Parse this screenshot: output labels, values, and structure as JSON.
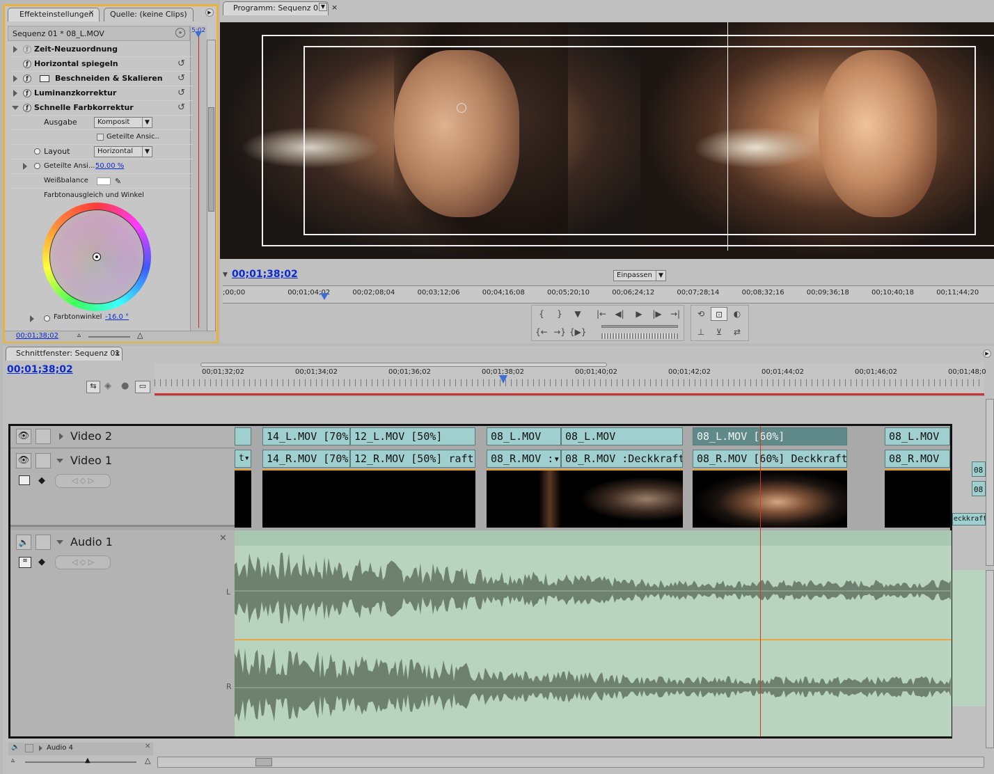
{
  "effects_panel": {
    "tab_effects": "Effekteinstellungen",
    "tab_source": "Quelle: (keine Clips)",
    "sequence_label": "Sequenz 01 * 08_L.MOV",
    "mini_time": "5:02",
    "effects": [
      {
        "name": "Zeit-Neuzuordnung"
      },
      {
        "name": "Horizontal spiegeln"
      },
      {
        "name": "Beschneiden & Skalieren"
      },
      {
        "name": "Luminanzkorrektur"
      },
      {
        "name": "Schnelle Farbkorrektur"
      }
    ],
    "ausgabe_label": "Ausgabe",
    "ausgabe_value": "Komposit",
    "geteilte_checkbox": "Geteilte Ansic..",
    "layout_label": "Layout",
    "layout_value": "Horizontal",
    "geteilte_label": "Geteilte Ansi...",
    "geteilte_value": "50.00 %",
    "weissbalance_label": "Weißbalance",
    "farbton_label": "Farbtonausgleich und Winkel",
    "farbtonwinkel_label": "Farbtonwinkel",
    "farbtonwinkel_value": "-16.0 °",
    "timecode": "00;01;38;02"
  },
  "program_monitor": {
    "tab": "Programm: Sequenz 01",
    "timecode": "00;01;38;02",
    "zoom": "Einpassen",
    "ruler": ";00;00|00;01;04;02|00;02;08;04|00;03;12;06|00;04;16;08|00;05;20;10|00;06;24;12|00;07;28;14|00;08;32;16|00;09;36;18|00;10;40;18|00;11;44;20|00;1"
  },
  "timeline": {
    "tab": "Schnittfenster: Sequenz 01",
    "timecode": "00;01;38;02",
    "ruler": "00;01;32;02|00;01;34;02|00;01;36;02|00;01;38;02|00;01;40;02|00;01;42;02|00;01;44;02|00;01;46;02|00;01;48;0",
    "tracks": {
      "video2": "Video 2",
      "video1": "Video 1",
      "audio1": "Audio 1",
      "audio4": "Audio 4"
    },
    "clips_v2": [
      "14_L.MOV [70%",
      "12_L.MOV [50%]",
      "08_L.MOV",
      "08_L.MOV",
      "08_L.MOV [60%]",
      "08_L.MOV"
    ],
    "clips_v1": [
      "t▾",
      "14_R.MOV [70%",
      "12_R.MOV [50%] raft▾",
      "08_R.MOV :▾",
      "08_R.MOV :Deckkraft▾",
      "08_R.MOV [60%] Deckkraft▾",
      "08_R.MOV"
    ],
    "side_clips": [
      "08",
      "08",
      "eckkraft▾"
    ],
    "channel_l": "L",
    "channel_r": "R"
  }
}
